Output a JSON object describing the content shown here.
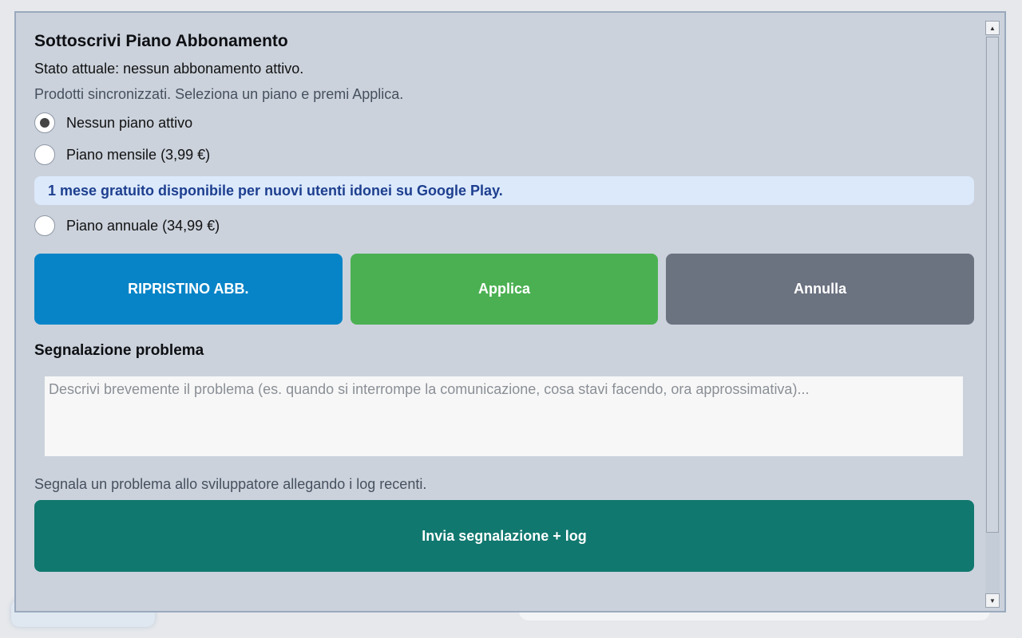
{
  "dialog": {
    "title": "Sottoscrivi Piano Abbonamento",
    "status": "Stato attuale: nessun abbonamento attivo.",
    "info": "Prodotti sincronizzati. Seleziona un piano e premi Applica."
  },
  "plans": [
    {
      "label": "Nessun piano attivo",
      "selected": true
    },
    {
      "label": "Piano mensile (3,99 €)",
      "selected": false
    },
    {
      "label": "Piano annuale (34,99 €)",
      "selected": false
    }
  ],
  "promo": "1 mese gratuito disponibile per nuovi utenti idonei su Google Play.",
  "buttons": {
    "restore": "RIPRISTINO ABB.",
    "apply": "Applica",
    "cancel": "Annulla",
    "send": "Invia segnalazione + log"
  },
  "report": {
    "title": "Segnalazione problema",
    "placeholder": "Descrivi brevemente il problema (es. quando si interrompe la comunicazione, cosa stavi facendo, ora approssimativa)...",
    "hint": "Segnala un problema allo sviluppatore allegando i log recenti."
  },
  "scrollbar": {
    "up_icon": "triangle-up-icon",
    "down_icon": "triangle-down-icon"
  },
  "colors": {
    "restore": "#0784c7",
    "apply": "#4bb052",
    "cancel": "#6b7280",
    "send": "#10786f",
    "promo_bg": "#dbe9fb",
    "promo_text": "#1e3f8f"
  }
}
